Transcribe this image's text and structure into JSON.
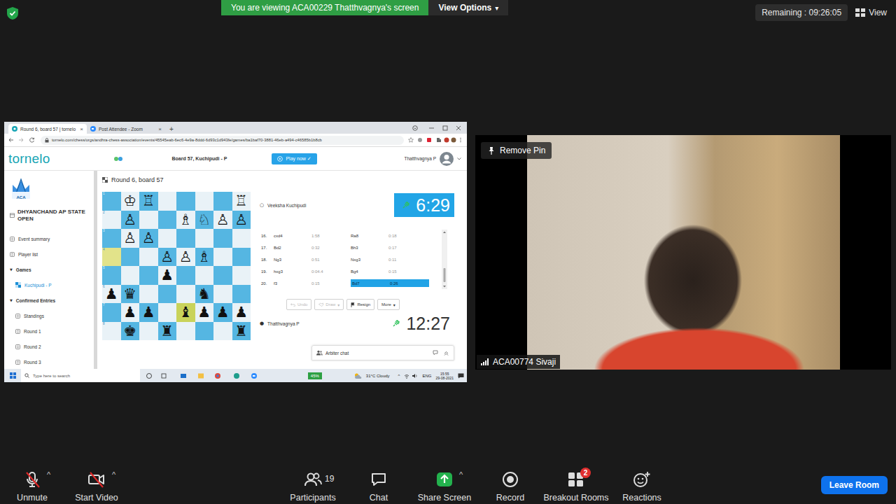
{
  "zoom": {
    "banner": {
      "text": "You are viewing ACA00229 Thatthvagnya's screen",
      "options": "View Options",
      "caret": "▾"
    },
    "remaining": "Remaining : 09:26:05",
    "view": "View",
    "video": {
      "remove_pin": "Remove Pin",
      "name": "ACA00774 Sivaji"
    },
    "toolbar": [
      {
        "label": "Unmute",
        "kind": "mic",
        "off": true,
        "caret": "^"
      },
      {
        "label": "Start Video",
        "kind": "video",
        "off": true,
        "caret": "^"
      },
      {
        "label": "Participants",
        "kind": "participants",
        "off": false,
        "count": "19"
      },
      {
        "label": "Chat",
        "kind": "chat",
        "off": false
      },
      {
        "label": "Share Screen",
        "kind": "share",
        "off": false,
        "caret": "^"
      },
      {
        "label": "Record",
        "kind": "record",
        "off": false
      },
      {
        "label": "Breakout Rooms",
        "kind": "breakout",
        "off": false,
        "badge": "2"
      },
      {
        "label": "Reactions",
        "kind": "reactions",
        "off": false
      }
    ],
    "leave": "Leave Room"
  },
  "browser": {
    "tabs": [
      {
        "label": "Round 6, board 57 | tornelo",
        "close": "×",
        "selected": true,
        "kind": "tornelo"
      },
      {
        "label": "Post Attendee - Zoom",
        "close": "×",
        "selected": false,
        "kind": "zoom"
      }
    ],
    "new_tab": "+",
    "url": "tornelo.com/chess/orgs/andhra-chess-association/events/45545eab-6ec6-4e9a-8ddd-6d93c1d943fe/games/ba1baf70-3881-46eb-a494-c46585b1b8cb"
  },
  "tornelo": {
    "logo": "tornelo",
    "board_title": "Board 57, Kuchipudi - P",
    "play_now": "Play now ✓",
    "user": "Thatthvagnya P",
    "event_logo": "ACA",
    "event_name": "DHYANCHAND AP STATE OPEN",
    "sidebar": [
      {
        "label": "Event summary",
        "kind": "link",
        "selected": false
      },
      {
        "label": "Player list",
        "kind": "link",
        "selected": false
      },
      {
        "label": "Games",
        "kind": "section",
        "arrow": "▼",
        "selected": false
      },
      {
        "label": "Kuchipudi - P",
        "kind": "sub",
        "selected": true
      },
      {
        "label": "Confirmed Entries",
        "kind": "section",
        "arrow": "▼",
        "selected": false
      },
      {
        "label": "Standings",
        "kind": "sub",
        "selected": false
      },
      {
        "label": "Round 1",
        "kind": "sub",
        "selected": false
      },
      {
        "label": "Round 2",
        "kind": "sub",
        "selected": false
      },
      {
        "label": "Round 3",
        "kind": "sub",
        "selected": false
      }
    ],
    "game": {
      "title": "Round 6, board 57",
      "board": {
        "ranks": [
          "1",
          "2",
          "3",
          "4",
          "5",
          "6",
          "7",
          "8"
        ],
        "rows": [
          {
            "pieces": [
              "",
              "♔",
              "♖",
              "",
              "",
              "",
              "",
              "♖"
            ],
            "highlight": [
              false,
              false,
              false,
              false,
              false,
              false,
              false,
              false
            ]
          },
          {
            "pieces": [
              "",
              "♙",
              "",
              "",
              "♗",
              "♘",
              "♙",
              "♙"
            ],
            "highlight": [
              false,
              false,
              false,
              false,
              false,
              false,
              false,
              false
            ]
          },
          {
            "pieces": [
              "",
              "♙",
              "♙",
              "",
              "",
              "",
              "",
              ""
            ],
            "highlight": [
              false,
              false,
              false,
              false,
              false,
              false,
              false,
              false
            ]
          },
          {
            "pieces": [
              "",
              "",
              "",
              "♙",
              "♙",
              "♗",
              "",
              ""
            ],
            "highlight": [
              true,
              false,
              false,
              false,
              false,
              false,
              false,
              false
            ]
          },
          {
            "pieces": [
              "",
              "",
              "",
              "♟",
              "",
              "",
              "",
              ""
            ],
            "highlight": [
              false,
              false,
              false,
              false,
              false,
              false,
              false,
              false
            ]
          },
          {
            "pieces": [
              "♟",
              "♛",
              "",
              "",
              "",
              "♞",
              "",
              ""
            ],
            "highlight": [
              false,
              false,
              false,
              false,
              false,
              false,
              false,
              false
            ]
          },
          {
            "pieces": [
              "",
              "♟",
              "♟",
              "",
              "♝",
              "♟",
              "♟",
              "♟"
            ],
            "highlight": [
              false,
              false,
              false,
              false,
              true,
              false,
              false,
              false
            ]
          },
          {
            "pieces": [
              "",
              "♚",
              "",
              "♜",
              "",
              "",
              "",
              "♜"
            ],
            "highlight": [
              false,
              false,
              false,
              false,
              false,
              false,
              false,
              false
            ]
          }
        ]
      },
      "opponent": {
        "marker": "○",
        "name": "Veeksha Kuchipudi",
        "clock": "6:29",
        "active": true
      },
      "player": {
        "marker": "●",
        "name": "Thatthvagnya P",
        "clock": "12:27",
        "active": false
      },
      "moves": [
        {
          "num": "16.",
          "white": {
            "move": "cxd4",
            "time": "1:58",
            "selected": false
          },
          "black": {
            "move": "Ra8",
            "time": "0:18",
            "selected": false
          }
        },
        {
          "num": "17.",
          "white": {
            "move": "Bd2",
            "time": "0:32",
            "selected": false
          },
          "black": {
            "move": "Bh3",
            "time": "0:17",
            "selected": false
          }
        },
        {
          "num": "18.",
          "white": {
            "move": "Ng3",
            "time": "0:51",
            "selected": false
          },
          "black": {
            "move": "Nxg3",
            "time": "0:11",
            "selected": false
          }
        },
        {
          "num": "19.",
          "white": {
            "move": "hxg3",
            "time": "0:04.4",
            "selected": false
          },
          "black": {
            "move": "Bg4",
            "time": "0:15",
            "selected": false
          }
        },
        {
          "num": "20.",
          "white": {
            "move": "f3",
            "time": "0:15",
            "selected": false
          },
          "black": {
            "move": "Bd7",
            "time": "0:26",
            "selected": true
          }
        }
      ],
      "actions": [
        {
          "label": "Undo",
          "kind": "undo",
          "disabled": true
        },
        {
          "label": "Draw",
          "kind": "draw",
          "caret": "▾",
          "disabled": true
        },
        {
          "label": "Resign",
          "kind": "resign",
          "disabled": false
        },
        {
          "label": "More",
          "kind": "more",
          "caret": "▾",
          "disabled": false
        }
      ],
      "arbiter_chat": "Arbiter chat"
    }
  },
  "taskbar": {
    "search": "Type here to search",
    "battery": "45%",
    "weather": "31°C  Cloudy",
    "tray_caret": "^",
    "lang": "ENG",
    "time": "15:55",
    "date": "29-08-2021"
  }
}
